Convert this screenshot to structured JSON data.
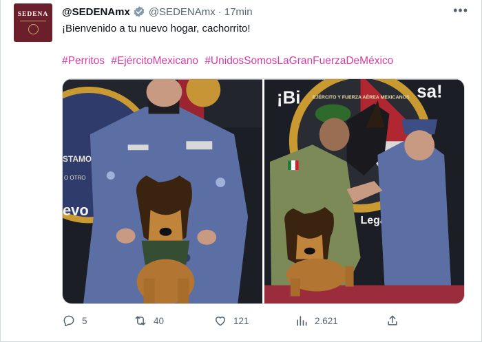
{
  "author": {
    "avatar_text": "SEDENA",
    "name": "@SEDENAmx",
    "handle": "@SEDENAmx",
    "time": "17min"
  },
  "post": {
    "text": "¡Bienvenido a tu nuevo hogar, cachorrito!",
    "hashtags": [
      "#Perritos",
      "#EjércitoMexicano",
      "#UnidosSomosLaGranFuerzaDeMéxico"
    ]
  },
  "media": {
    "left_visible_text": [
      "STAMOS",
      "O OTRO",
      "evo"
    ],
    "right_visible_text": [
      "¡Bi",
      "sa!",
      "EJÉRCITO Y FUERZA AÉREA MEXICANOS",
      "Legac"
    ]
  },
  "stats": {
    "replies": "5",
    "reposts": "40",
    "likes": "121",
    "views": "2.621"
  },
  "colors": {
    "hashtag": "#d53ca6",
    "muted": "#536471",
    "verified": "#829aab",
    "avatar_bg": "#6b1f2a"
  }
}
